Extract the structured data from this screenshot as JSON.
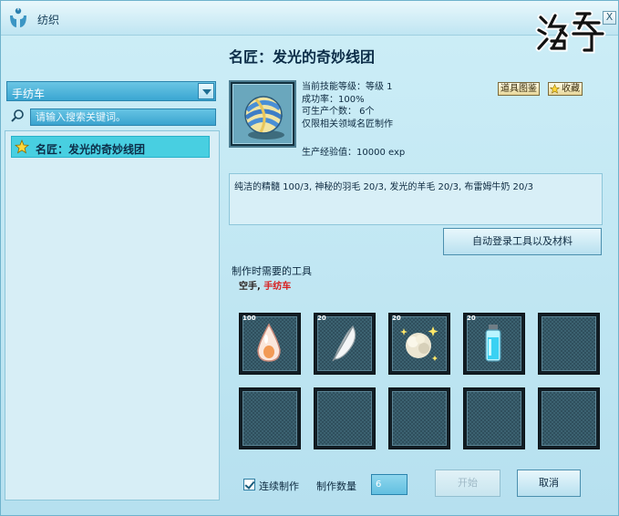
{
  "window": {
    "title": "纺织",
    "close_label": "X",
    "watermark": "洛奇"
  },
  "recipe": {
    "name": "名匠：发光的奇妙线团",
    "skill_level": "当前技能等级：等级 1",
    "success_rate": "成功率：100%",
    "quantity": "可生产个数： 6个",
    "restriction": "仅限相关领域名匠制作",
    "exp": "生产经验值：10000 exp",
    "badge_book": "道具图鉴",
    "badge_fav": "收藏",
    "materials_text": "纯洁的精髓 100/3, 神秘的羽毛 20/3, 发光的羊毛 20/3, 布雷姆牛奶 20/3"
  },
  "left_panel": {
    "dropdown_value": "手纺车",
    "search_placeholder": "请输入搜索关键词。",
    "items": [
      {
        "label": "名匠：发光的奇妙线团"
      }
    ]
  },
  "actions": {
    "auto_register": "自动登录工具以及材料",
    "start": "开始",
    "cancel": "取消"
  },
  "tools": {
    "label": "制作时需要的工具",
    "prefix": "空手,",
    "name": "手纺车"
  },
  "slots": [
    {
      "count": "100",
      "item": "essence-icon"
    },
    {
      "count": "20",
      "item": "feather-icon"
    },
    {
      "count": "20",
      "item": "glowing-wool-icon"
    },
    {
      "count": "20",
      "item": "milk-bottle-icon"
    },
    {
      "count": "",
      "item": ""
    },
    {
      "count": "",
      "item": ""
    },
    {
      "count": "",
      "item": ""
    },
    {
      "count": "",
      "item": ""
    },
    {
      "count": "",
      "item": ""
    },
    {
      "count": "",
      "item": ""
    }
  ],
  "bottom": {
    "continuous_label": "连续制作",
    "quantity_label": "制作数量",
    "quantity_value": "6"
  }
}
